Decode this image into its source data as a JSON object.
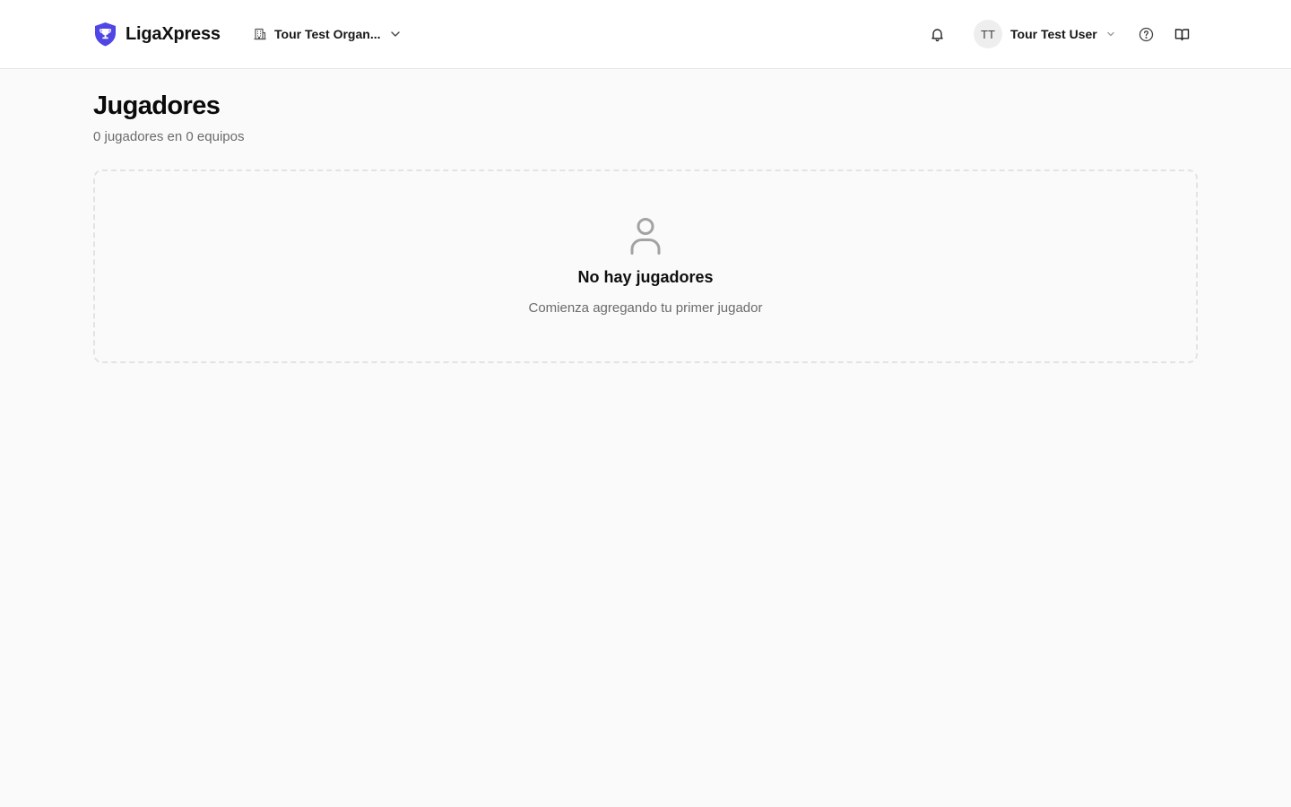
{
  "header": {
    "brand_name": "LigaXpress",
    "brand_color": "#4f46e5",
    "organization": {
      "name": "Tour Test Organ...",
      "icon": "building-icon",
      "dropdown_icon": "chevron-down-icon"
    },
    "notifications_icon": "bell-icon",
    "user": {
      "initials": "TT",
      "name": "Tour Test User",
      "dropdown_icon": "chevron-down-icon"
    },
    "help_icon": "help-circle-icon",
    "docs_icon": "book-open-icon"
  },
  "page": {
    "title": "Jugadores",
    "subtitle": "0 jugadores en 0 equipos"
  },
  "empty_state": {
    "icon": "user-icon",
    "title": "No hay jugadores",
    "description": "Comienza agregando tu primer jugador"
  }
}
